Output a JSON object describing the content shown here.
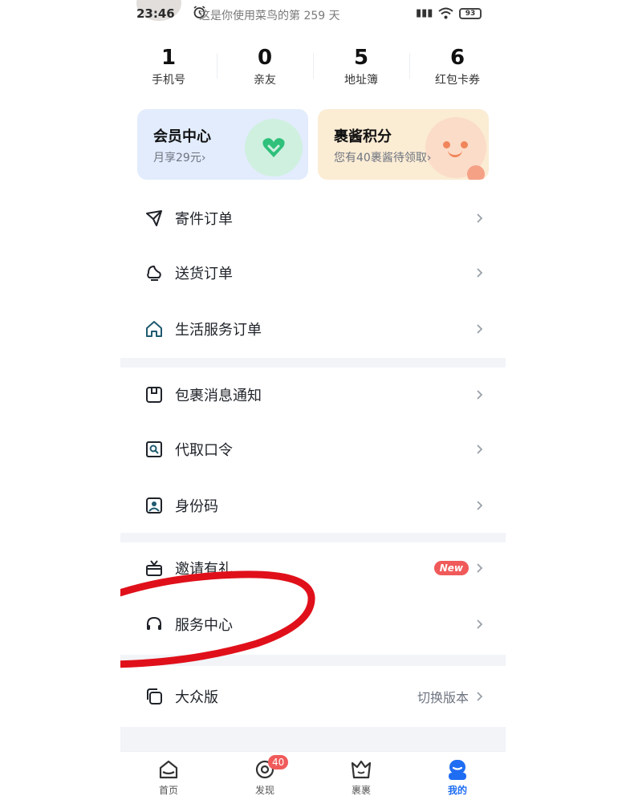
{
  "status_bar": {
    "time": "23:46",
    "notice": "这是你使用菜鸟的第 259 天",
    "battery": "93",
    "network": "HD"
  },
  "stats": [
    {
      "value": "1",
      "label": "手机号"
    },
    {
      "value": "0",
      "label": "亲友"
    },
    {
      "value": "5",
      "label": "地址簿"
    },
    {
      "value": "6",
      "label": "红包卡券"
    }
  ],
  "cards": {
    "member": {
      "title": "会员中心",
      "subtitle": "月享29元",
      "arrow": "›"
    },
    "points": {
      "title": "裹酱积分",
      "subtitle": "您有40裹酱待领取",
      "arrow": "›"
    }
  },
  "orders": [
    {
      "icon": "send-icon",
      "label": "寄件订单"
    },
    {
      "icon": "delivery-icon",
      "label": "送货订单"
    },
    {
      "icon": "home-icon",
      "label": "生活服务订单"
    }
  ],
  "tools": [
    {
      "icon": "package-notice-icon",
      "label": "包裹消息通知"
    },
    {
      "icon": "pickup-code-icon",
      "label": "代取口令"
    },
    {
      "icon": "id-code-icon",
      "label": "身份码"
    }
  ],
  "service": [
    {
      "icon": "gift-icon",
      "label": "邀请有礼",
      "badge": "New"
    },
    {
      "icon": "headset-icon",
      "label": "服务中心"
    }
  ],
  "edition": {
    "icon": "copy-icon",
    "label": "大众版",
    "right_text": "切换版本"
  },
  "tabbar": {
    "items": [
      {
        "icon": "home-tab-icon",
        "label": "首页"
      },
      {
        "icon": "discover-icon",
        "label": "发现",
        "badge": "40"
      },
      {
        "icon": "guoguo-icon",
        "label": "裹裹"
      },
      {
        "icon": "profile-icon",
        "label": "我的",
        "active": true
      }
    ]
  },
  "colors": {
    "accent": "#1f6df2",
    "badge_red": "#f05a5a",
    "annotation_red": "#e0101a",
    "member_card": "#e2ecfd",
    "points_card": "#fbecd4",
    "divider": "#f2f4f8"
  }
}
